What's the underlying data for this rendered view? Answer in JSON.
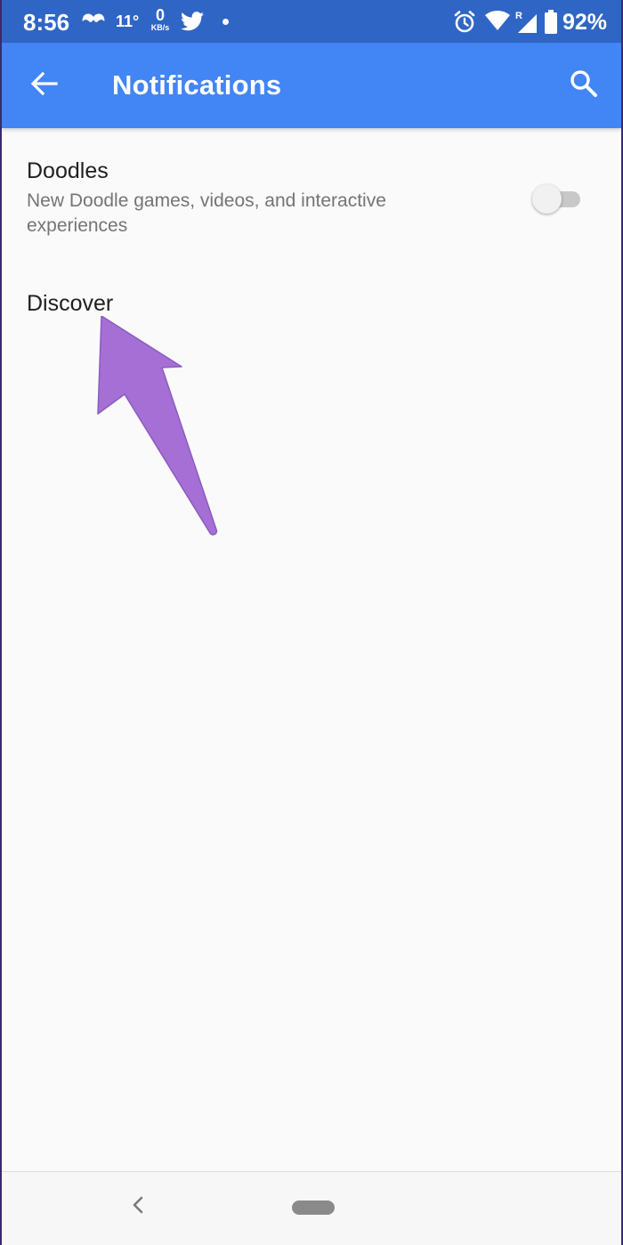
{
  "status_bar": {
    "time": "8:56",
    "temperature": "11°",
    "net_speed_value": "0",
    "net_speed_unit": "KB/s",
    "battery": "92%",
    "signal_badge": "R",
    "icons": [
      "mustache-icon",
      "twitter-icon",
      "notification-dot-icon",
      "alarm-icon",
      "wifi-icon",
      "cell-signal-icon",
      "battery-icon"
    ]
  },
  "app_bar": {
    "title": "Notifications",
    "back_icon": "arrow-back-icon",
    "search_icon": "search-icon"
  },
  "settings": {
    "doodles": {
      "title": "Doodles",
      "subtitle": "New Doodle games, videos, and interactive experiences",
      "enabled": false
    },
    "discover": {
      "title": "Discover"
    }
  },
  "annotation": {
    "type": "arrow",
    "color": "#a56fd6"
  },
  "nav_bar": {
    "back_icon": "chevron-left-icon",
    "home_icon": "home-pill-icon"
  },
  "colors": {
    "status_bar": "#2f66c5",
    "app_bar": "#4285f4",
    "background": "#fafafa",
    "title_text": "#202020",
    "subtitle_text": "#757575"
  }
}
